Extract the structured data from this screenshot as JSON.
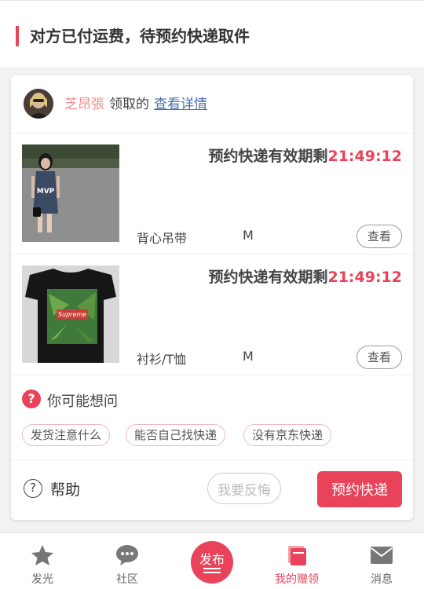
{
  "header": {
    "title": "对方已付运费，待预约快递取件"
  },
  "receiver": {
    "name": "芝昂張",
    "verb": "领取的",
    "detail_link": "查看详情"
  },
  "items": [
    {
      "countdown_label": "预约快递有效期剩",
      "countdown_time": "21:49:12",
      "category": "背心吊带",
      "size": "M",
      "view_label": "查看",
      "image": "woman-in-tank-dress-photo"
    },
    {
      "countdown_label": "预约快递有效期剩",
      "countdown_time": "21:49:12",
      "category": "衬衫/T恤",
      "size": "M",
      "view_label": "查看",
      "image": "black-tshirt-green-leaf-print-photo"
    }
  ],
  "faq": {
    "icon": "question-circle-icon",
    "title": "你可能想问",
    "chips": [
      "发货注意什么",
      "能否自己找快递",
      "没有京东快递"
    ]
  },
  "actions": {
    "help_label": "帮助",
    "regret_label": "我要反悔",
    "book_label": "预约快递"
  },
  "tabbar": {
    "tabs": [
      {
        "label": "发光",
        "icon": "star-icon"
      },
      {
        "label": "社区",
        "icon": "chat-bubble-icon"
      },
      {
        "label": "发布",
        "icon": "publish-icon"
      },
      {
        "label": "我的赠领",
        "icon": "gift-box-icon",
        "active": true
      },
      {
        "label": "消息",
        "icon": "envelope-icon"
      }
    ]
  },
  "colors": {
    "accent": "#e8435a",
    "link": "#4a6fb3",
    "name": "#ef8c8c"
  }
}
